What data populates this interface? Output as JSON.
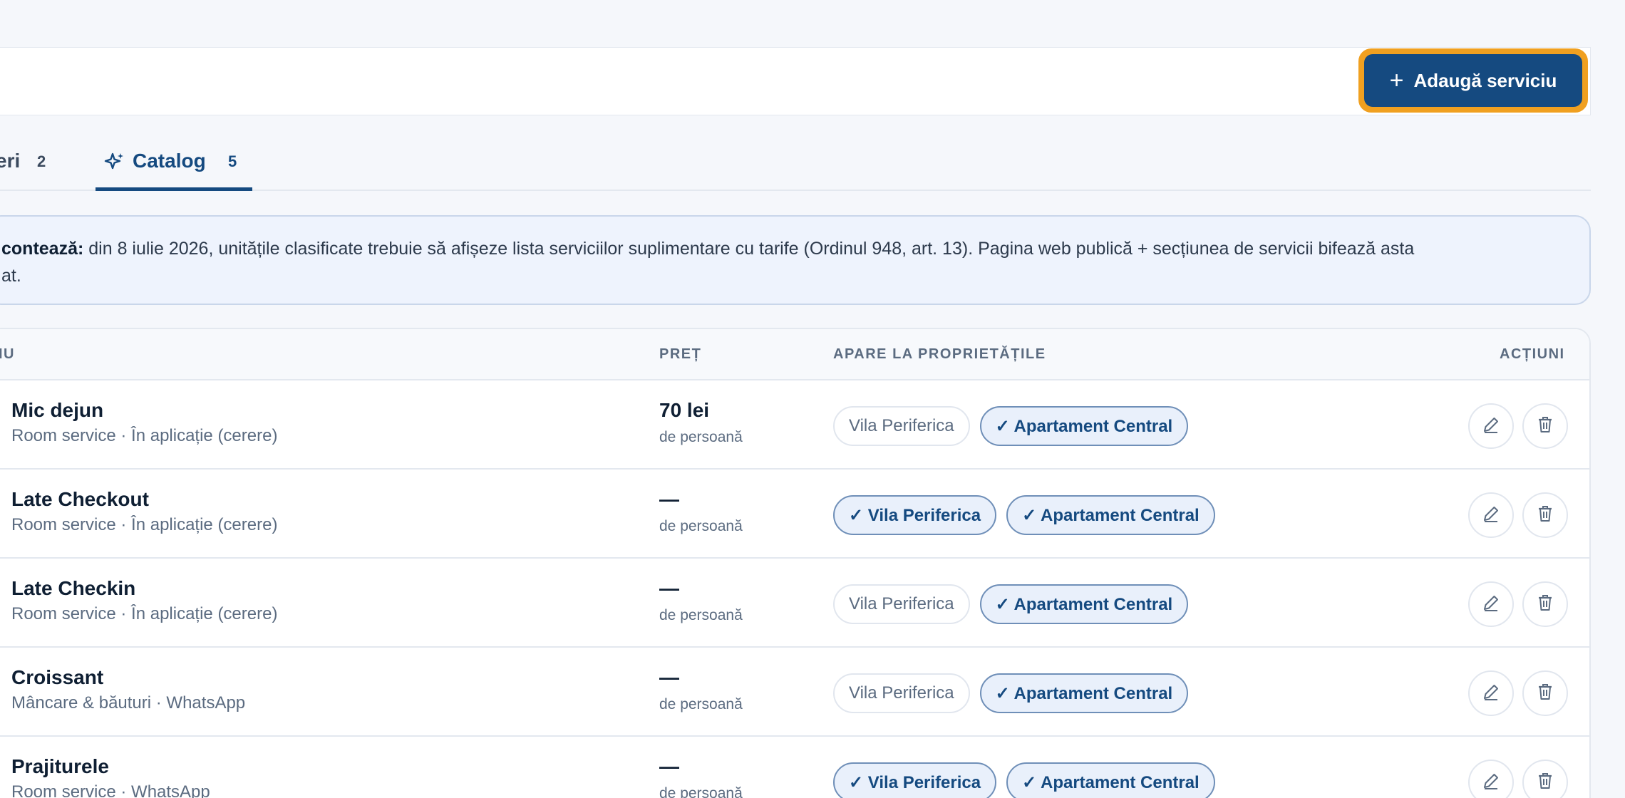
{
  "header": {
    "add_button_label": "Adaugă serviciu"
  },
  "tabs": {
    "previous": {
      "label": "eri",
      "count": "2"
    },
    "active": {
      "label": "Catalog",
      "count": "5"
    }
  },
  "notice": {
    "bold": "contează:",
    "text": " din 8 iulie 2026, unitățile clasificate trebuie să afișeze lista serviciilor suplimentare cu tarife (Ordinul 948, art. 13). Pagina web publică + secțiunea de servicii bifează asta",
    "line2": "at."
  },
  "table": {
    "columns": {
      "service": "CIU",
      "price": "PREȚ",
      "properties": "APARE LA PROPRIETĂȚILE",
      "actions": "ACȚIUNI"
    },
    "rows": [
      {
        "name": "Mic dejun",
        "meta": "Room service · În aplicație (cerere)",
        "price": "70 lei",
        "unit": "de persoană",
        "chips": [
          {
            "label": "Vila Periferica",
            "on": false
          },
          {
            "label": "✓ Apartament Central",
            "on": true
          }
        ]
      },
      {
        "name": "Late Checkout",
        "meta": "Room service · În aplicație (cerere)",
        "price": "—",
        "unit": "de persoană",
        "chips": [
          {
            "label": "✓ Vila Periferica",
            "on": true
          },
          {
            "label": "✓ Apartament Central",
            "on": true
          }
        ]
      },
      {
        "name": "Late Checkin",
        "meta": "Room service · În aplicație (cerere)",
        "price": "—",
        "unit": "de persoană",
        "chips": [
          {
            "label": "Vila Periferica",
            "on": false
          },
          {
            "label": "✓ Apartament Central",
            "on": true
          }
        ]
      },
      {
        "name": "Croissant",
        "meta": "Mâncare & băuturi · WhatsApp",
        "price": "—",
        "unit": "de persoană",
        "chips": [
          {
            "label": "Vila Periferica",
            "on": false
          },
          {
            "label": "✓ Apartament Central",
            "on": true
          }
        ]
      },
      {
        "name": "Prajiturele",
        "meta": "Room service · WhatsApp",
        "price": "—",
        "unit": "de persoană",
        "chips": [
          {
            "label": "✓ Vila Periferica",
            "on": true
          },
          {
            "label": "✓ Apartament Central",
            "on": true
          }
        ]
      }
    ]
  },
  "icons": {
    "add": "plus-icon",
    "catalog": "sparkle-icon",
    "edit": "pencil-icon",
    "delete": "trash-icon"
  },
  "colors": {
    "accent": "#154a80",
    "focus_ring": "#f0a020"
  }
}
